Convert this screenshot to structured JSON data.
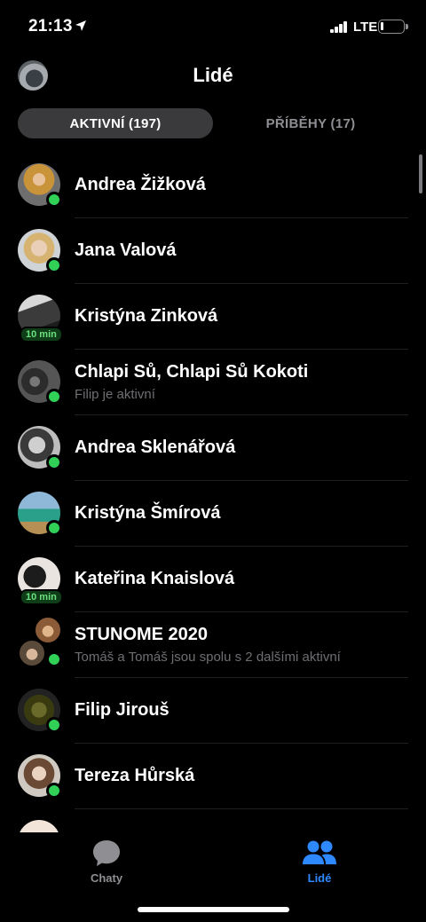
{
  "status": {
    "time": "21:13",
    "network": "LTE"
  },
  "header": {
    "title": "Lidé"
  },
  "tabs": {
    "active": "AKTIVNÍ (197)",
    "inactive": "PŘÍBĚHY (17)"
  },
  "people": [
    {
      "name": "Andrea Žižková",
      "status": "online"
    },
    {
      "name": "Jana Valová",
      "status": "online"
    },
    {
      "name": "Kristýna Zinková",
      "badge": "10 min"
    },
    {
      "name": "Chlapi Sů, Chlapi Sů Kokoti",
      "subtitle": "Filip je aktivní",
      "status": "online"
    },
    {
      "name": "Andrea Sklenářová",
      "status": "online"
    },
    {
      "name": "Kristýna Šmírová",
      "status": "online"
    },
    {
      "name": "Kateřina Knaislová",
      "badge": "10 min"
    },
    {
      "name": "STUNOME 2020",
      "subtitle": "Tomáš a Tomáš jsou spolu s 2 dalšími aktivní",
      "status": "online"
    },
    {
      "name": "Filip Jirouš",
      "status": "online"
    },
    {
      "name": "Tereza Hůrská",
      "status": "online"
    }
  ],
  "tabbar": {
    "chats": "Chaty",
    "people": "Lidé"
  },
  "colors": {
    "online": "#31d158",
    "accent": "#2e89ff",
    "inactive": "#8e8e93"
  }
}
